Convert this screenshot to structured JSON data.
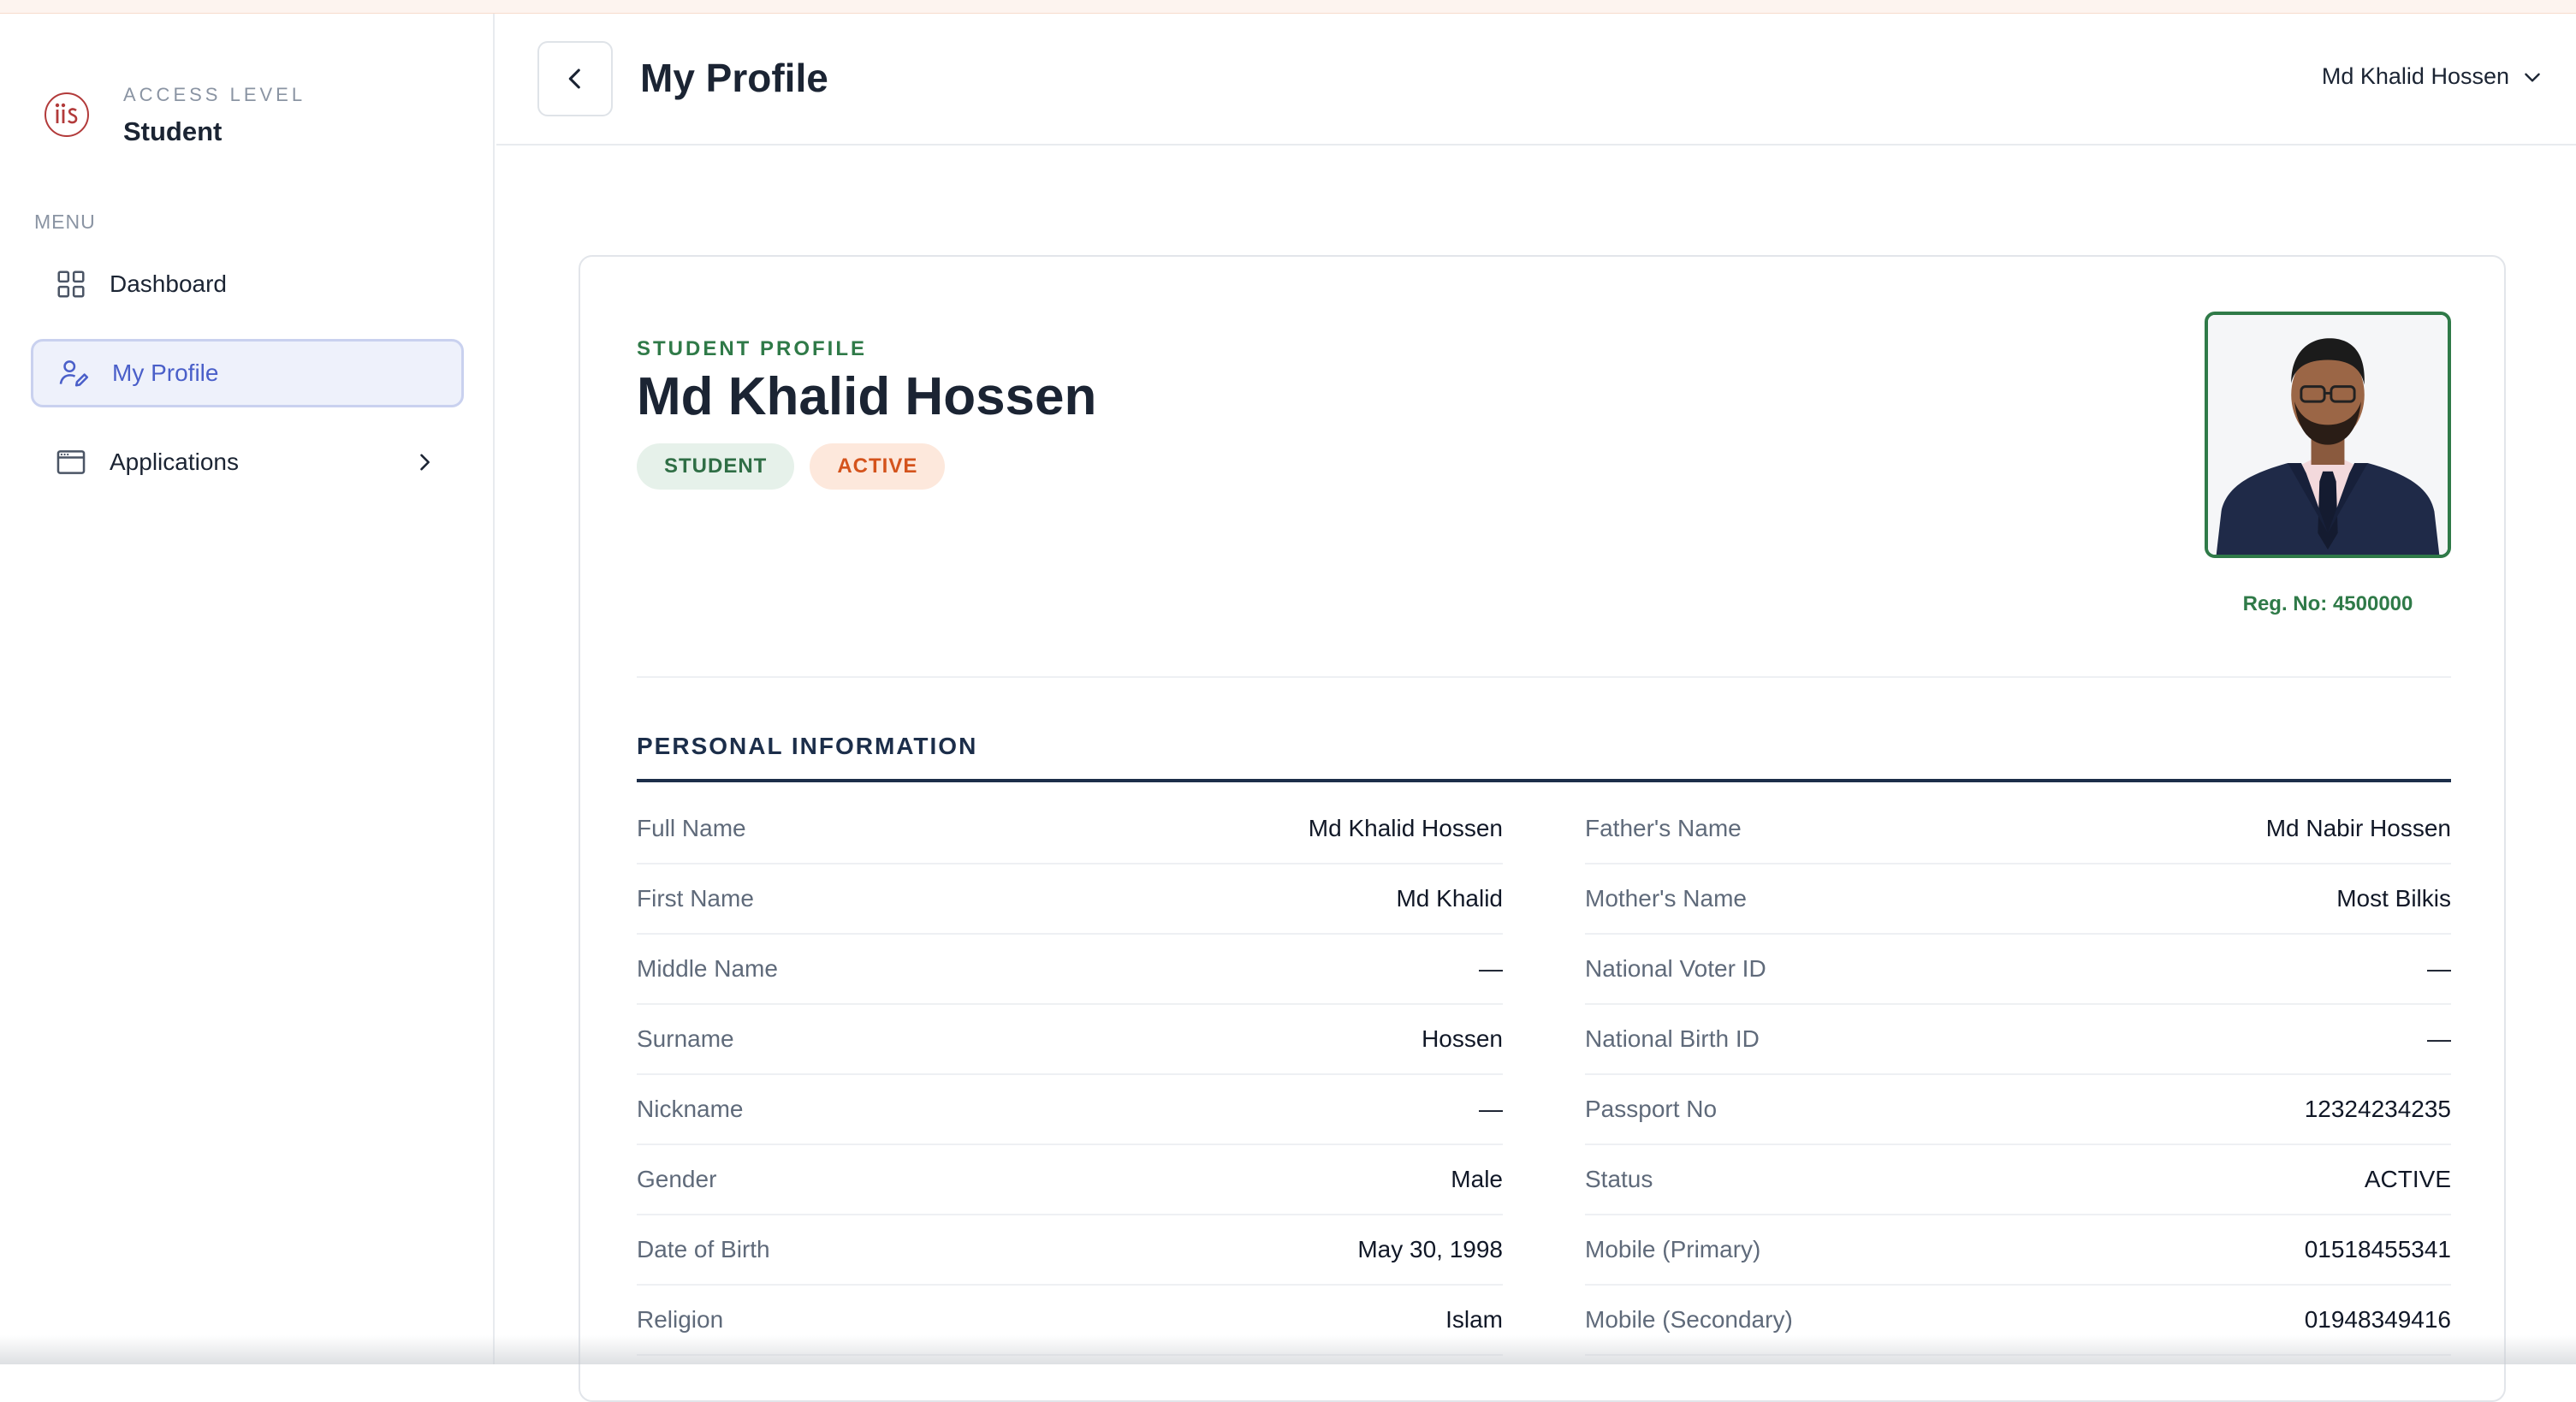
{
  "sidebar": {
    "access_label": "ACCESS LEVEL",
    "access_value": "Student",
    "menu_label": "MENU",
    "items": [
      {
        "label": "Dashboard",
        "icon": "grid-icon"
      },
      {
        "label": "My Profile",
        "icon": "user-edit-icon",
        "active": true
      },
      {
        "label": "Applications",
        "icon": "window-icon",
        "has_children": true
      }
    ]
  },
  "header": {
    "title": "My Profile",
    "user_name": "Md Khalid Hossen"
  },
  "profile": {
    "eyebrow": "STUDENT PROFILE",
    "name": "Md Khalid Hossen",
    "badges": [
      "STUDENT",
      "ACTIVE"
    ],
    "reg_no": "Reg. No: 4500000"
  },
  "personal_info": {
    "title": "PERSONAL INFORMATION",
    "left": [
      {
        "label": "Full Name",
        "value": "Md Khalid Hossen"
      },
      {
        "label": "First Name",
        "value": "Md Khalid"
      },
      {
        "label": "Middle Name",
        "value": "—"
      },
      {
        "label": "Surname",
        "value": "Hossen"
      },
      {
        "label": "Nickname",
        "value": "—"
      },
      {
        "label": "Gender",
        "value": "Male"
      },
      {
        "label": "Date of Birth",
        "value": "May 30, 1998"
      },
      {
        "label": "Religion",
        "value": "Islam"
      }
    ],
    "right": [
      {
        "label": "Father's Name",
        "value": "Md Nabir Hossen"
      },
      {
        "label": "Mother's Name",
        "value": "Most Bilkis"
      },
      {
        "label": "National Voter ID",
        "value": "—"
      },
      {
        "label": "National Birth ID",
        "value": "—"
      },
      {
        "label": "Passport No",
        "value": "12324234235"
      },
      {
        "label": "Status",
        "value": "ACTIVE"
      },
      {
        "label": "Mobile (Primary)",
        "value": "01518455341"
      },
      {
        "label": "Mobile (Secondary)",
        "value": "01948349416"
      }
    ]
  },
  "colors": {
    "accent_green": "#2f7a48",
    "accent_blue": "#4a5fc9",
    "active_orange": "#d4531c",
    "navy": "#1c2e4a"
  }
}
